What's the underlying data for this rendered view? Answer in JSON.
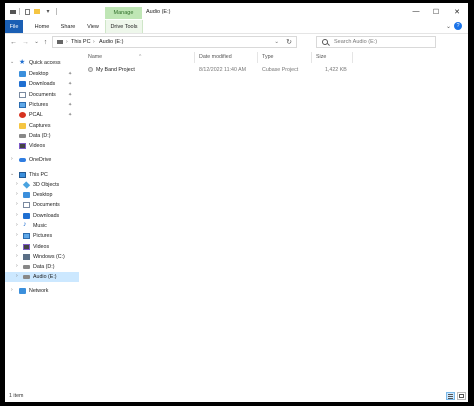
{
  "window": {
    "title": "Audio (E:)",
    "manage_tab": "Manage",
    "quick_access_toolbar": {
      "dropdown_glyph": "▾"
    },
    "controls": {
      "minimize": "—",
      "maximize": "☐",
      "close": "✕"
    }
  },
  "ribbon": {
    "tabs": [
      {
        "label": "File"
      },
      {
        "label": "Home"
      },
      {
        "label": "Share"
      },
      {
        "label": "View"
      },
      {
        "label": "Drive Tools"
      }
    ],
    "expand_glyph": "⌄",
    "help_glyph": "?"
  },
  "address": {
    "back_glyph": "←",
    "forward_glyph": "→",
    "recent_glyph": "⌄",
    "up_glyph": "↑",
    "breadcrumbs": [
      "This PC",
      "Audio (E:)"
    ],
    "separator": "›",
    "dropdown_glyph": "⌄",
    "refresh_glyph": "↻",
    "search_placeholder": "Search Audio (E:)"
  },
  "nav": {
    "quick_access": {
      "label": "Quick access",
      "icon": "star-icon"
    },
    "pinned": [
      {
        "label": "Desktop",
        "icon": "desktop-icon",
        "pinned": true
      },
      {
        "label": "Downloads",
        "icon": "downloads-icon",
        "pinned": true
      },
      {
        "label": "Documents",
        "icon": "documents-icon",
        "pinned": true
      },
      {
        "label": "Pictures",
        "icon": "pictures-icon",
        "pinned": true
      },
      {
        "label": "PCAL",
        "icon": "app-icon",
        "pinned": true
      },
      {
        "label": "Captures",
        "icon": "folder-icon",
        "pinned": false
      },
      {
        "label": "Data (D:)",
        "icon": "drive-icon",
        "pinned": false
      },
      {
        "label": "Videos",
        "icon": "videos-icon",
        "pinned": false
      }
    ],
    "pin_glyph": "✦",
    "onedrive": {
      "label": "OneDrive",
      "icon": "cloud-icon"
    },
    "this_pc": {
      "label": "This PC",
      "icon": "computer-icon"
    },
    "this_pc_items": [
      {
        "label": "3D Objects",
        "icon": "cube-icon"
      },
      {
        "label": "Desktop",
        "icon": "desktop-icon"
      },
      {
        "label": "Documents",
        "icon": "documents-icon"
      },
      {
        "label": "Downloads",
        "icon": "downloads-icon"
      },
      {
        "label": "Music",
        "icon": "music-icon"
      },
      {
        "label": "Pictures",
        "icon": "pictures-icon"
      },
      {
        "label": "Videos",
        "icon": "videos-icon"
      },
      {
        "label": "Windows (C:)",
        "icon": "windows-drive-icon"
      },
      {
        "label": "Data (D:)",
        "icon": "drive-icon"
      },
      {
        "label": "Audio (E:)",
        "icon": "drive-icon",
        "selected": true
      }
    ],
    "network": {
      "label": "Network",
      "icon": "network-icon"
    },
    "expanded_glyph": "⌄",
    "collapsed_glyph": "›"
  },
  "columns": [
    "Name",
    "Date modified",
    "Type",
    "Size"
  ],
  "sort_glyph": "^",
  "files": [
    {
      "name": "My Band Project",
      "date_modified": "8/12/2022 11:40 AM",
      "type": "Cubase Project",
      "size": "1,422 KB",
      "icon": "cubase-project-icon"
    }
  ],
  "status": {
    "item_count": "1 item"
  },
  "colors": {
    "accent": "#1a5fb4",
    "selection": "#cce8ff",
    "manage_tab": "#bfe6b5"
  }
}
